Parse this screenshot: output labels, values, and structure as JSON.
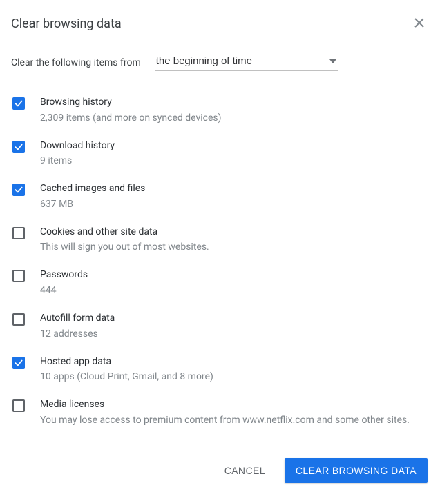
{
  "dialog": {
    "title": "Clear browsing data",
    "from_label": "Clear the following items from",
    "time_range_selected": "the beginning of time"
  },
  "items": [
    {
      "id": "browsing-history",
      "title": "Browsing history",
      "sub": "2,309 items (and more on synced devices)",
      "checked": true
    },
    {
      "id": "download-history",
      "title": "Download history",
      "sub": "9 items",
      "checked": true
    },
    {
      "id": "cached-files",
      "title": "Cached images and files",
      "sub": "637 MB",
      "checked": true
    },
    {
      "id": "cookies",
      "title": "Cookies and other site data",
      "sub": "This will sign you out of most websites.",
      "checked": false
    },
    {
      "id": "passwords",
      "title": "Passwords",
      "sub": "444",
      "checked": false
    },
    {
      "id": "autofill",
      "title": "Autofill form data",
      "sub": "12 addresses",
      "checked": false
    },
    {
      "id": "hosted-app",
      "title": "Hosted app data",
      "sub": "10 apps (Cloud Print, Gmail, and 8 more)",
      "checked": true
    },
    {
      "id": "media-licenses",
      "title": "Media licenses",
      "sub": "You may lose access to premium content from www.netflix.com and some other sites.",
      "checked": false
    }
  ],
  "actions": {
    "cancel": "Cancel",
    "confirm": "Clear browsing data"
  }
}
